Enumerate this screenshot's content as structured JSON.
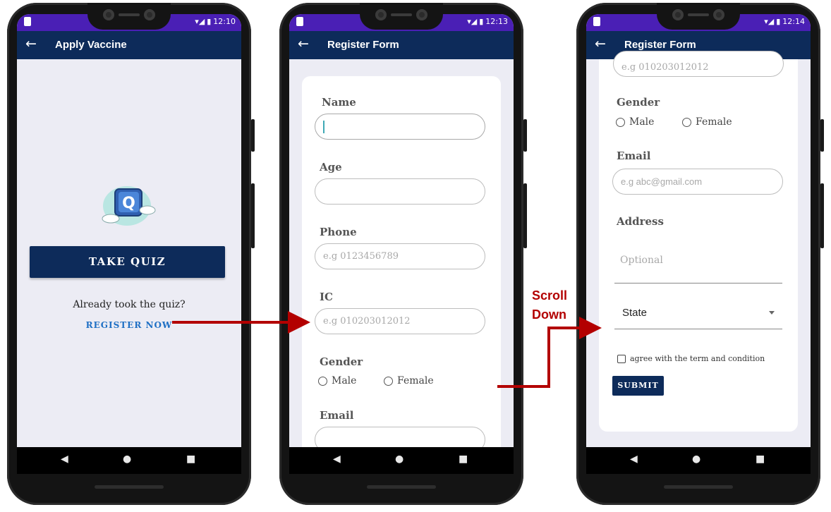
{
  "phones": [
    {
      "status_time": "12:10",
      "appbar_title": "Apply Vaccine"
    },
    {
      "status_time": "12:13",
      "appbar_title": "Register Form"
    },
    {
      "status_time": "12:14",
      "appbar_title": "Register Form"
    }
  ],
  "screen1": {
    "take_quiz_label": "TAKE QUIZ",
    "already_text": "Already took the quiz?",
    "register_label": "REGISTER NOW",
    "logo_letter": "Q"
  },
  "screen2": {
    "name_label": "Name",
    "age_label": "Age",
    "phone_label": "Phone",
    "phone_placeholder": "e.g 0123456789",
    "ic_label": "IC",
    "ic_placeholder": "e.g 010203012012",
    "gender_label": "Gender",
    "male_label": "Male",
    "female_label": "Female",
    "email_label": "Email"
  },
  "screen3": {
    "ic_placeholder": "e.g 010203012012",
    "gender_label": "Gender",
    "male_label": "Male",
    "female_label": "Female",
    "email_label": "Email",
    "email_placeholder": "e.g abc@gmail.com",
    "address_label": "Address",
    "address_placeholder": "Optional",
    "state_label": "State",
    "agree_label": "agree with the term and condition",
    "submit_label": "SUBMIT"
  },
  "annotation": {
    "line1": "Scroll",
    "line2": "Down"
  },
  "colors": {
    "appbar": "#0d2b5a",
    "statusbar": "#4a1fb5",
    "arrow": "#b30000",
    "link": "#1e6fc4"
  },
  "icons": {
    "back": "back-arrow-icon",
    "nav_back": "nav-back-icon",
    "nav_home": "nav-home-icon",
    "nav_recent": "nav-recent-icon"
  }
}
